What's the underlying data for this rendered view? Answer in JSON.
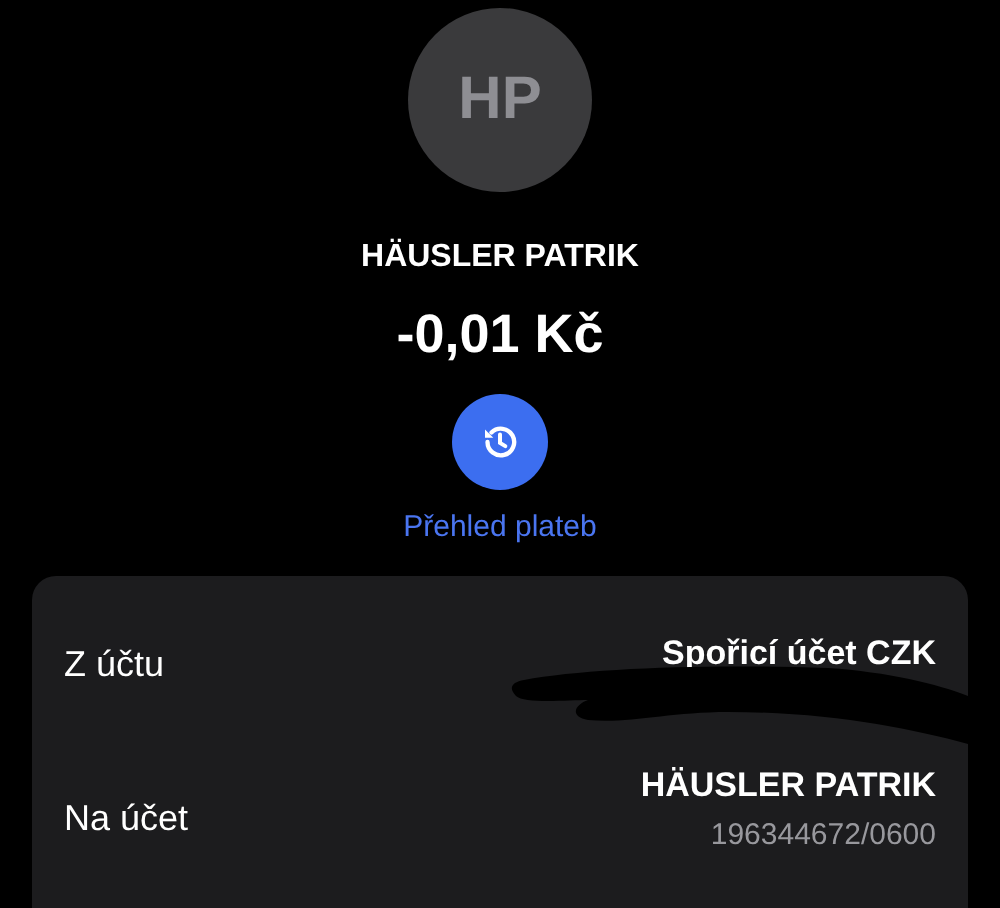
{
  "avatar": {
    "initials": "HP"
  },
  "name": "HÄUSLER PATRIK",
  "amount": "-0,01 Kč",
  "history_link": "Přehled plateb",
  "rows": [
    {
      "label": "Z účtu",
      "value": "Spořicí účet CZK",
      "redacted": true
    },
    {
      "label": "Na účet",
      "value": "HÄUSLER PATRIK",
      "detail": "196344672/0600",
      "redacted": false
    }
  ]
}
